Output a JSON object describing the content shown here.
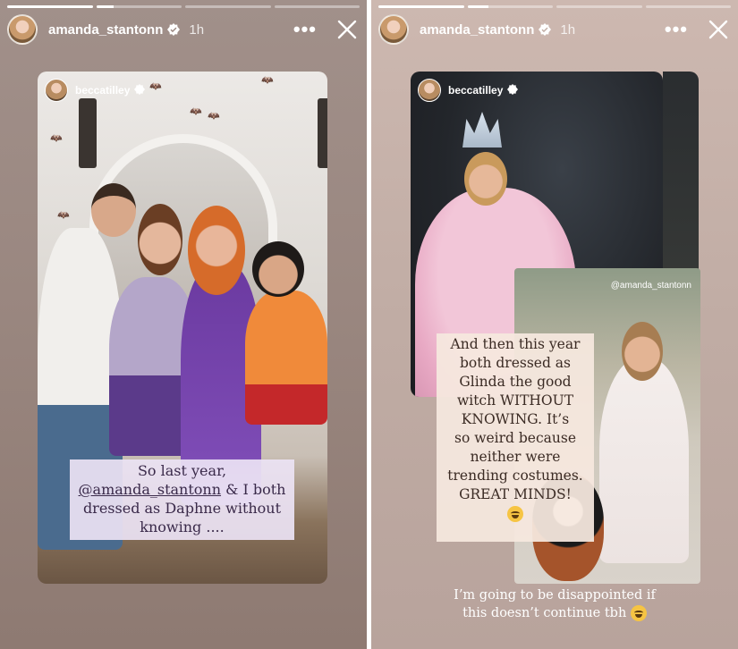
{
  "stories": [
    {
      "username": "amanda_stantonn",
      "time": "1h",
      "more_label": "•••",
      "progress": [
        1,
        0.2,
        0,
        0
      ],
      "post_handle": "beccatilley",
      "caption_lines": [
        "So last year,",
        "@amanda_stantonn",
        " & I both",
        "dressed as Daphne without",
        "knowing ...."
      ]
    },
    {
      "username": "amanda_stantonn",
      "time": "1h",
      "more_label": "•••",
      "progress": [
        1,
        0.25,
        0,
        0
      ],
      "post_handle": "beccatilley",
      "inner_handle": "@amanda_stantonn",
      "caption_lines": [
        "And then this year",
        "both dressed as",
        "Glinda the good",
        "witch WITHOUT",
        "KNOWING. It’s",
        "so weird because",
        "neither were",
        "trending costumes.",
        "GREAT MINDS!"
      ],
      "bottom_lines": [
        "I’m going to be disappointed if",
        "this doesn’t continue tbh"
      ]
    }
  ],
  "icons": {
    "verified": "verified-badge-icon",
    "more": "more-options-icon",
    "close": "close-icon",
    "emoji": "laughing-emoji-icon"
  },
  "colors": {
    "caption_1_bg": "#ece3f4",
    "caption_2_bg": "#f5e8de",
    "verified_blue": "#ffffff"
  }
}
